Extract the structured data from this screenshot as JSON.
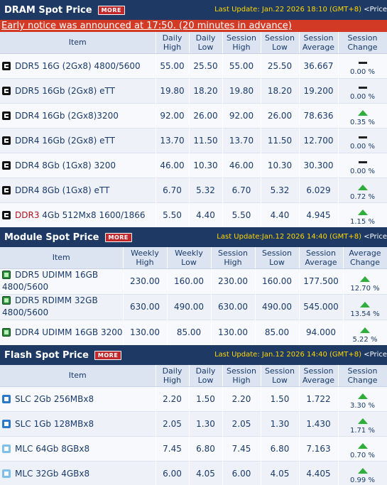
{
  "dram": {
    "title": "DRAM Spot Price",
    "more_label": "MORE",
    "update_text": "Last Update: Jan.22 2026 18:10 (GMT+8)",
    "price_link": "<Price",
    "notice": "Early notice was announced at 17:50. (20 minutes in advance)",
    "headers": [
      "Item",
      "Daily High",
      "Daily Low",
      "Session High",
      "Session Low",
      "Session Average",
      "Session Change"
    ],
    "rows": [
      {
        "prefix": "",
        "item": "DDR5 16G (2Gx8) 4800/5600",
        "c1": "55.00",
        "c2": "25.50",
        "c3": "55.00",
        "c4": "25.50",
        "c5": "36.667",
        "change": "0.00 %",
        "dir": "flat"
      },
      {
        "prefix": "",
        "item": "DDR5 16Gb (2Gx8) eTT",
        "c1": "19.80",
        "c2": "18.20",
        "c3": "19.80",
        "c4": "18.20",
        "c5": "19.200",
        "change": "0.00 %",
        "dir": "flat"
      },
      {
        "prefix": "",
        "item": "DDR4 16Gb (2Gx8)3200",
        "c1": "92.00",
        "c2": "26.00",
        "c3": "92.00",
        "c4": "26.00",
        "c5": "78.636",
        "change": "0.35 %",
        "dir": "up"
      },
      {
        "prefix": "",
        "item": "DDR4 16Gb (2Gx8) eTT",
        "c1": "13.70",
        "c2": "11.50",
        "c3": "13.70",
        "c4": "11.50",
        "c5": "12.700",
        "change": "0.00 %",
        "dir": "flat"
      },
      {
        "prefix": "",
        "item": "DDR4 8Gb (1Gx8) 3200",
        "c1": "46.00",
        "c2": "10.30",
        "c3": "46.00",
        "c4": "10.30",
        "c5": "30.300",
        "change": "0.00 %",
        "dir": "flat"
      },
      {
        "prefix": "",
        "item": "DDR4 8Gb (1Gx8) eTT",
        "c1": "6.70",
        "c2": "5.32",
        "c3": "6.70",
        "c4": "5.32",
        "c5": "6.029",
        "change": "0.72 %",
        "dir": "up"
      },
      {
        "prefix": "DDR3",
        "item": " 4Gb 512Mx8 1600/1866",
        "c1": "5.50",
        "c2": "4.40",
        "c3": "5.50",
        "c4": "4.40",
        "c5": "4.945",
        "change": "1.15 %",
        "dir": "up"
      }
    ]
  },
  "module": {
    "title": "Module Spot Price",
    "more_label": "MORE",
    "update_text": "Last Update:Jan.12 2026 14:40 (GMT+8)",
    "price_link": "<Price",
    "headers": [
      "Item",
      "Weekly High",
      "Weekly Low",
      "Session High",
      "Session Low",
      "Session Average",
      "Average Change"
    ],
    "rows": [
      {
        "item": "DDR5 UDIMM 16GB 4800/5600",
        "c1": "230.00",
        "c2": "160.00",
        "c3": "230.00",
        "c4": "160.00",
        "c5": "177.500",
        "change": "12.70 %",
        "dir": "up"
      },
      {
        "item": "DDR5 RDIMM 32GB 4800/5600",
        "c1": "630.00",
        "c2": "490.00",
        "c3": "630.00",
        "c4": "490.00",
        "c5": "545.000",
        "change": "13.54 %",
        "dir": "up"
      },
      {
        "item": "DDR4 UDIMM 16GB 3200",
        "c1": "130.00",
        "c2": "85.00",
        "c3": "130.00",
        "c4": "85.00",
        "c5": "94.000",
        "change": "5.22 %",
        "dir": "up"
      }
    ]
  },
  "flash": {
    "title": "Flash Spot Price",
    "more_label": "MORE",
    "update_text": "Last Update: Jan.12 2026 14:40 (GMT+8)",
    "price_link": "<Price",
    "headers": [
      "Item",
      "Daily High",
      "Daily Low",
      "Session High",
      "Session Low",
      "Session Average",
      "Session Change"
    ],
    "rows": [
      {
        "item": "SLC 2Gb 256MBx8",
        "chip": "s",
        "c1": "2.20",
        "c2": "1.50",
        "c3": "2.20",
        "c4": "1.50",
        "c5": "1.722",
        "change": "3.30 %",
        "dir": "up"
      },
      {
        "item": "SLC 1Gb 128MBx8",
        "chip": "s",
        "c1": "2.05",
        "c2": "1.30",
        "c3": "2.05",
        "c4": "1.30",
        "c5": "1.430",
        "change": "1.71 %",
        "dir": "up"
      },
      {
        "item": "MLC 64Gb 8GBx8",
        "chip": "ml",
        "c1": "7.45",
        "c2": "6.80",
        "c3": "7.45",
        "c4": "6.80",
        "c5": "7.163",
        "change": "0.70 %",
        "dir": "up"
      },
      {
        "item": "MLC 32Gb 4GBx8",
        "chip": "ml",
        "c1": "6.00",
        "c2": "4.05",
        "c3": "6.00",
        "c4": "4.05",
        "c5": "4.405",
        "change": "0.99 %",
        "dir": "up"
      }
    ]
  },
  "colors": {
    "header_bg": "#1e3a64",
    "update_text": "#ffd600",
    "notice_bg": "#d23a26",
    "more_bg": "#c0282c",
    "up_arrow": "#2fae3c",
    "table_head_bg": "#dbe4f0"
  }
}
